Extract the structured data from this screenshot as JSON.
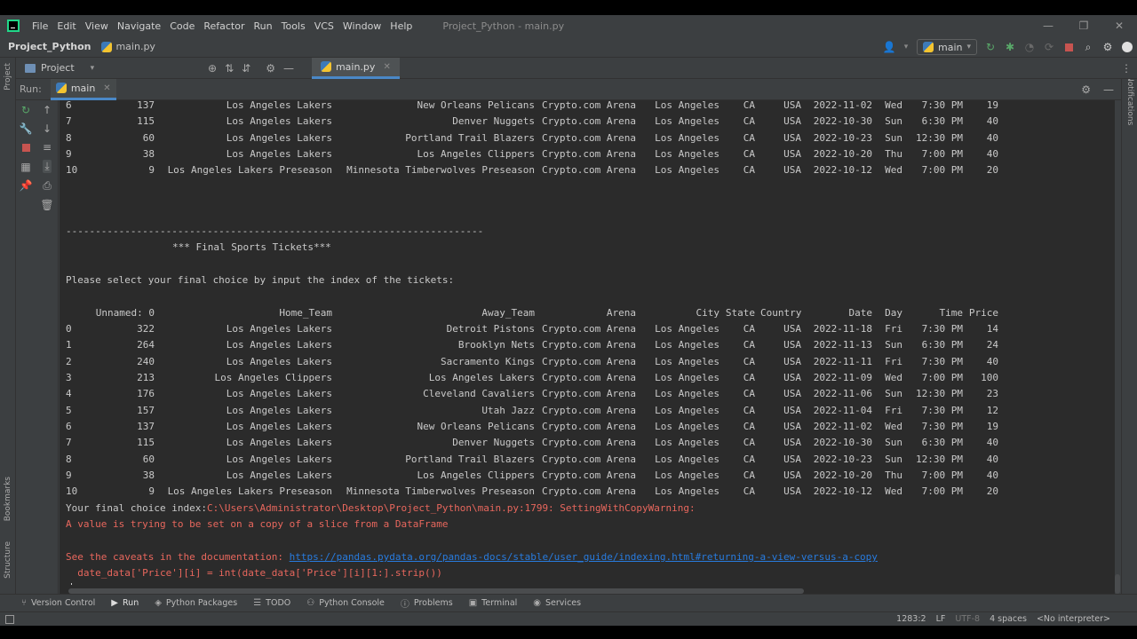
{
  "menubar": {
    "items": [
      "File",
      "Edit",
      "View",
      "Navigate",
      "Code",
      "Refactor",
      "Run",
      "Tools",
      "VCS",
      "Window",
      "Help"
    ],
    "title": "Project_Python - main.py"
  },
  "navbar": {
    "project": "Project_Python",
    "file": "main.py",
    "run_config": "main"
  },
  "toolrow": {
    "project_label": "Project",
    "editor_tab": "main.py"
  },
  "left_strip": {
    "project": "Project",
    "bookmarks": "Bookmarks",
    "structure": "Structure"
  },
  "right_strip": {
    "notifications": "Notifications"
  },
  "run_panel": {
    "label": "Run:",
    "tab": "main"
  },
  "console": {
    "top_rows": [
      [
        "6",
        "137",
        "Los Angeles Lakers",
        "New Orleans Pelicans",
        "Crypto.com Arena",
        "Los Angeles",
        "CA",
        "USA",
        "2022-11-02",
        "Wed",
        "7:30 PM",
        "19"
      ],
      [
        "7",
        "115",
        "Los Angeles Lakers",
        "Denver Nuggets",
        "Crypto.com Arena",
        "Los Angeles",
        "CA",
        "USA",
        "2022-10-30",
        "Sun",
        "6:30 PM",
        "40"
      ],
      [
        "8",
        "60",
        "Los Angeles Lakers",
        "Portland Trail Blazers",
        "Crypto.com Arena",
        "Los Angeles",
        "CA",
        "USA",
        "2022-10-23",
        "Sun",
        "12:30 PM",
        "40"
      ],
      [
        "9",
        "38",
        "Los Angeles Lakers",
        "Los Angeles Clippers",
        "Crypto.com Arena",
        "Los Angeles",
        "CA",
        "USA",
        "2022-10-20",
        "Thu",
        "7:00 PM",
        "40"
      ],
      [
        "10",
        "9",
        "Los Angeles Lakers Preseason",
        "Minnesota Timberwolves Preseason",
        "Crypto.com Arena",
        "Los Angeles",
        "CA",
        "USA",
        "2022-10-12",
        "Wed",
        "7:00 PM",
        "20"
      ]
    ],
    "divider": "-----------------------------------------------------------------------",
    "section_title": "*** Final Sports Tickets***",
    "prompt": "Please select your final choice by input the index of the tickets:",
    "headers": [
      "Unnamed: 0",
      "Home_Team",
      "Away_Team",
      "Arena",
      "City",
      "State",
      "Country",
      "Date",
      "Day",
      "Time",
      "Price"
    ],
    "rows": [
      [
        "0",
        "322",
        "Los Angeles Lakers",
        "Detroit Pistons",
        "Crypto.com Arena",
        "Los Angeles",
        "CA",
        "USA",
        "2022-11-18",
        "Fri",
        "7:30 PM",
        "14"
      ],
      [
        "1",
        "264",
        "Los Angeles Lakers",
        "Brooklyn Nets",
        "Crypto.com Arena",
        "Los Angeles",
        "CA",
        "USA",
        "2022-11-13",
        "Sun",
        "6:30 PM",
        "24"
      ],
      [
        "2",
        "240",
        "Los Angeles Lakers",
        "Sacramento Kings",
        "Crypto.com Arena",
        "Los Angeles",
        "CA",
        "USA",
        "2022-11-11",
        "Fri",
        "7:30 PM",
        "40"
      ],
      [
        "3",
        "213",
        "Los Angeles Clippers",
        "Los Angeles Lakers",
        "Crypto.com Arena",
        "Los Angeles",
        "CA",
        "USA",
        "2022-11-09",
        "Wed",
        "7:00 PM",
        "100"
      ],
      [
        "4",
        "176",
        "Los Angeles Lakers",
        "Cleveland Cavaliers",
        "Crypto.com Arena",
        "Los Angeles",
        "CA",
        "USA",
        "2022-11-06",
        "Sun",
        "12:30 PM",
        "23"
      ],
      [
        "5",
        "157",
        "Los Angeles Lakers",
        "Utah Jazz",
        "Crypto.com Arena",
        "Los Angeles",
        "CA",
        "USA",
        "2022-11-04",
        "Fri",
        "7:30 PM",
        "12"
      ],
      [
        "6",
        "137",
        "Los Angeles Lakers",
        "New Orleans Pelicans",
        "Crypto.com Arena",
        "Los Angeles",
        "CA",
        "USA",
        "2022-11-02",
        "Wed",
        "7:30 PM",
        "19"
      ],
      [
        "7",
        "115",
        "Los Angeles Lakers",
        "Denver Nuggets",
        "Crypto.com Arena",
        "Los Angeles",
        "CA",
        "USA",
        "2022-10-30",
        "Sun",
        "6:30 PM",
        "40"
      ],
      [
        "8",
        "60",
        "Los Angeles Lakers",
        "Portland Trail Blazers",
        "Crypto.com Arena",
        "Los Angeles",
        "CA",
        "USA",
        "2022-10-23",
        "Sun",
        "12:30 PM",
        "40"
      ],
      [
        "9",
        "38",
        "Los Angeles Lakers",
        "Los Angeles Clippers",
        "Crypto.com Arena",
        "Los Angeles",
        "CA",
        "USA",
        "2022-10-20",
        "Thu",
        "7:00 PM",
        "40"
      ],
      [
        "10",
        "9",
        "Los Angeles Lakers Preseason",
        "Minnesota Timberwolves Preseason",
        "Crypto.com Arena",
        "Los Angeles",
        "CA",
        "USA",
        "2022-10-12",
        "Wed",
        "7:00 PM",
        "20"
      ]
    ],
    "input_prompt": "Your final choice index:",
    "warning_path": "C:\\Users\\Administrator\\Desktop\\Project_Python\\main.py:1799: SettingWithCopyWarning:",
    "warning_msg": "A value is trying to be set on a copy of a slice from a DataFrame",
    "caveats": "See the caveats in the documentation: ",
    "doc_link": "https://pandas.pydata.org/pandas-docs/stable/user_guide/indexing.html#returning-a-view-versus-a-copy",
    "code_line": "  date_data['Price'][i] = int(date_data['Price'][i][1:].strip())"
  },
  "bottom_tabs": [
    "Version Control",
    "Run",
    "Python Packages",
    "TODO",
    "Python Console",
    "Problems",
    "Terminal",
    "Services"
  ],
  "statusbar": {
    "position": "1283:2",
    "line_sep": "LF",
    "encoding": "UTF-8",
    "indent": "4 spaces",
    "interpreter": "<No interpreter>"
  },
  "colors": {
    "accent": "#4a88c7",
    "error": "#e8675d",
    "link": "#287bde",
    "console_bg": "#2b2b2b",
    "chrome_bg": "#3c3f41"
  }
}
